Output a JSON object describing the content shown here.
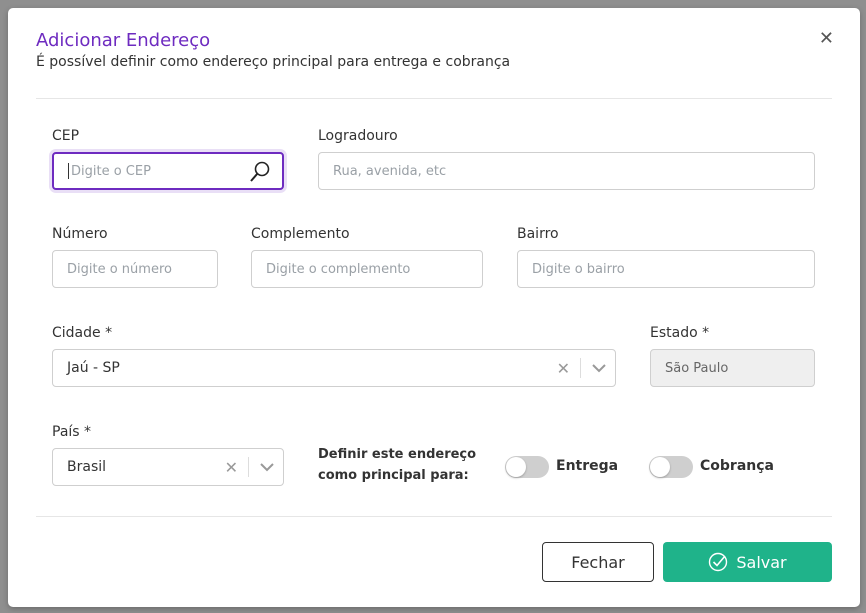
{
  "dialog": {
    "title": "Adicionar Endereço",
    "subtitle": "É possível definir como endereço principal para entrega e cobrança",
    "close_icon": "close-icon"
  },
  "form": {
    "cep": {
      "label": "CEP",
      "placeholder": "Digite o CEP",
      "icon": "search-icon"
    },
    "logradouro": {
      "label": "Logradouro",
      "placeholder": "Rua, avenida, etc"
    },
    "numero": {
      "label": "Número",
      "placeholder": "Digite o número"
    },
    "complemento": {
      "label": "Complemento",
      "placeholder": "Digite o complemento"
    },
    "bairro": {
      "label": "Bairro",
      "placeholder": "Digite o bairro"
    },
    "cidade": {
      "label": "Cidade *",
      "value": "Jaú - SP"
    },
    "estado": {
      "label": "Estado *",
      "value": "São Paulo"
    },
    "pais": {
      "label": "País *",
      "value": "Brasil"
    },
    "principal_info": "Definir este endereço como principal para:",
    "toggles": [
      {
        "label": "Entrega",
        "on": false
      },
      {
        "label": "Cobrança",
        "on": false
      }
    ]
  },
  "footer": {
    "cancel_label": "Fechar",
    "save_label": "Salvar",
    "save_icon": "check-circle-icon"
  },
  "colors": {
    "accent": "#6e2bc0",
    "primary_button": "#1fb38a"
  }
}
